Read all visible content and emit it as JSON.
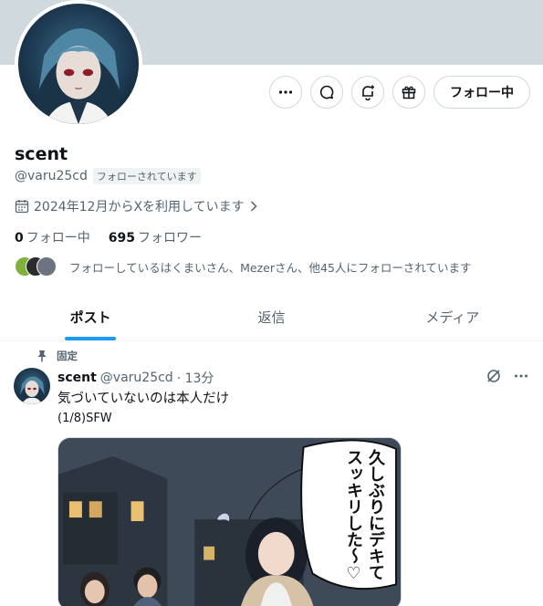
{
  "profile": {
    "name": "scent",
    "handle": "@varu25cd",
    "follows_you": "フォローされています",
    "joined": "2024年12月からXを利用しています",
    "following_count": "0",
    "following_label": "フォロー中",
    "followers_count": "695",
    "followers_label": "フォロワー",
    "followed_by": "フォローしているはくまいさん、Mezerさん、他45人にフォローされています"
  },
  "actions": {
    "more_icon": "more-icon",
    "message_icon": "message-icon",
    "notify_icon": "bell-plus-icon",
    "gift_icon": "gift-icon",
    "follow_label": "フォロー中"
  },
  "tabs": [
    {
      "label": "ポスト",
      "active": true
    },
    {
      "label": "返信",
      "active": false
    },
    {
      "label": "メディア",
      "active": false
    }
  ],
  "post": {
    "pinned_label": "固定",
    "author": "scent",
    "handle": "@varu25cd",
    "time": "· 13分",
    "text": "気づいていないのは本人だけ",
    "subtext": "(1/8)SFW",
    "image_bubble": "久しぶりにデキてスッキリした〜♡"
  },
  "colors": {
    "accent": "#1d9bf0",
    "banner": "#cfd9de",
    "text_secondary": "#536471"
  }
}
